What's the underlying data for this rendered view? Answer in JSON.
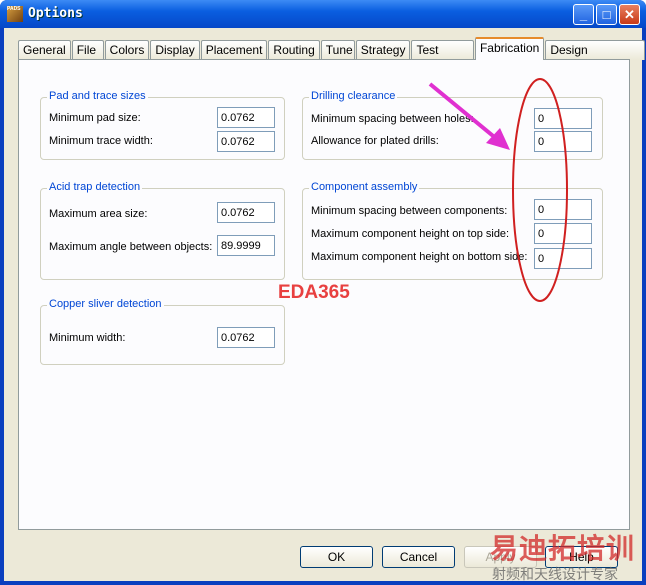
{
  "window": {
    "title": "Options"
  },
  "tabs": [
    "General",
    "File",
    "Colors",
    "Display",
    "Placement",
    "Routing",
    "Tune",
    "Strategy",
    "Test points",
    "Fabrication",
    "Design verification"
  ],
  "active_tab": "Fabrication",
  "groups": {
    "pad_trace": {
      "title": "Pad and trace sizes",
      "min_pad_label": "Minimum pad size:",
      "min_pad": "0.0762",
      "min_trace_label": "Minimum trace width:",
      "min_trace": "0.0762"
    },
    "acid_trap": {
      "title": "Acid trap detection",
      "max_area_label": "Maximum area size:",
      "max_area": "0.0762",
      "max_angle_label": "Maximum angle between objects:",
      "max_angle": "89.9999"
    },
    "copper_sliver": {
      "title": "Copper sliver detection",
      "min_width_label": "Minimum width:",
      "min_width": "0.0762"
    },
    "drilling": {
      "title": "Drilling clearance",
      "min_spacing_label": "Minimum spacing between holes:",
      "min_spacing": "0",
      "allowance_label": "Allowance for plated drills:",
      "allowance": "0"
    },
    "component": {
      "title": "Component assembly",
      "min_spacing_label": "Minimum spacing between components:",
      "min_spacing": "0",
      "max_top_label": "Maximum component height on top side:",
      "max_top": "0",
      "max_bottom_label": "Maximum component height on bottom side:",
      "max_bottom": "0"
    }
  },
  "buttons": {
    "ok": "OK",
    "cancel": "Cancel",
    "apply": "Apply",
    "help": "Help"
  },
  "watermarks": {
    "eda": "EDA365",
    "cn1": "易迪拓培训",
    "cn2": "射频和天线设计专家"
  },
  "colors": {
    "annotation_ellipse": "#d02020",
    "annotation_arrow": "#e030d0"
  }
}
